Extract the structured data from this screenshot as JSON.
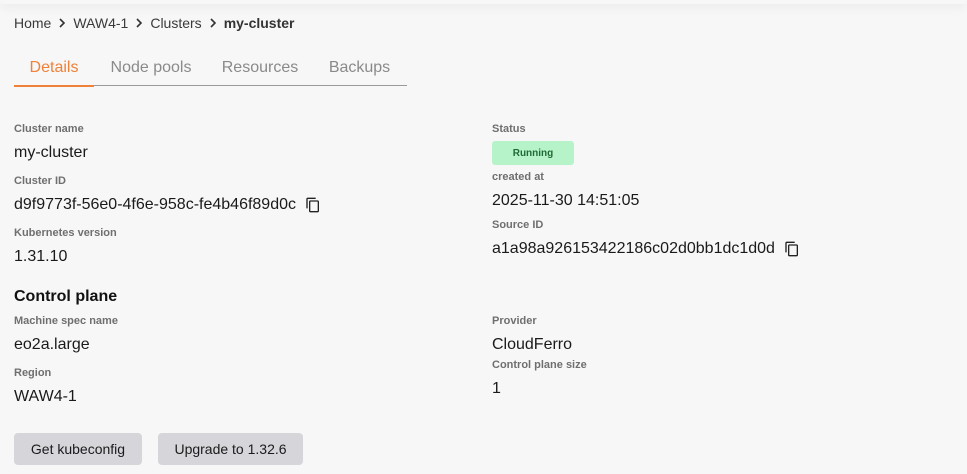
{
  "breadcrumb": {
    "items": [
      "Home",
      "WAW4-1",
      "Clusters"
    ],
    "current": "my-cluster"
  },
  "tabs": [
    {
      "label": "Details",
      "active": true
    },
    {
      "label": "Node pools",
      "active": false
    },
    {
      "label": "Resources",
      "active": false
    },
    {
      "label": "Backups",
      "active": false
    }
  ],
  "details": {
    "cluster_name_label": "Cluster name",
    "cluster_name": "my-cluster",
    "cluster_id_label": "Cluster ID",
    "cluster_id": "d9f9773f-56e0-4f6e-958c-fe4b46f89d0c",
    "kubernetes_version_label": "Kubernetes version",
    "kubernetes_version": "1.31.10",
    "status_label": "Status",
    "status": "Running",
    "created_at_label": "created at",
    "created_at": "2025-11-30 14:51:05",
    "source_id_label": "Source ID",
    "source_id": "a1a98a926153422186c02d0bb1dc1d0d"
  },
  "control_plane": {
    "title": "Control plane",
    "machine_spec_label": "Machine spec name",
    "machine_spec": "eo2a.large",
    "region_label": "Region",
    "region": "WAW4-1",
    "provider_label": "Provider",
    "provider": "CloudFerro",
    "size_label": "Control plane size",
    "size": "1"
  },
  "actions": {
    "kubeconfig_label": "Get kubeconfig",
    "upgrade_label": "Upgrade to 1.32.6"
  },
  "icons": {
    "chevron": "chevron-right-icon",
    "copy": "copy-icon"
  },
  "colors": {
    "accent": "#f0813a",
    "status_bg": "#b7f3c9",
    "status_text": "#1f6b35",
    "button_bg": "#d6d6da"
  }
}
